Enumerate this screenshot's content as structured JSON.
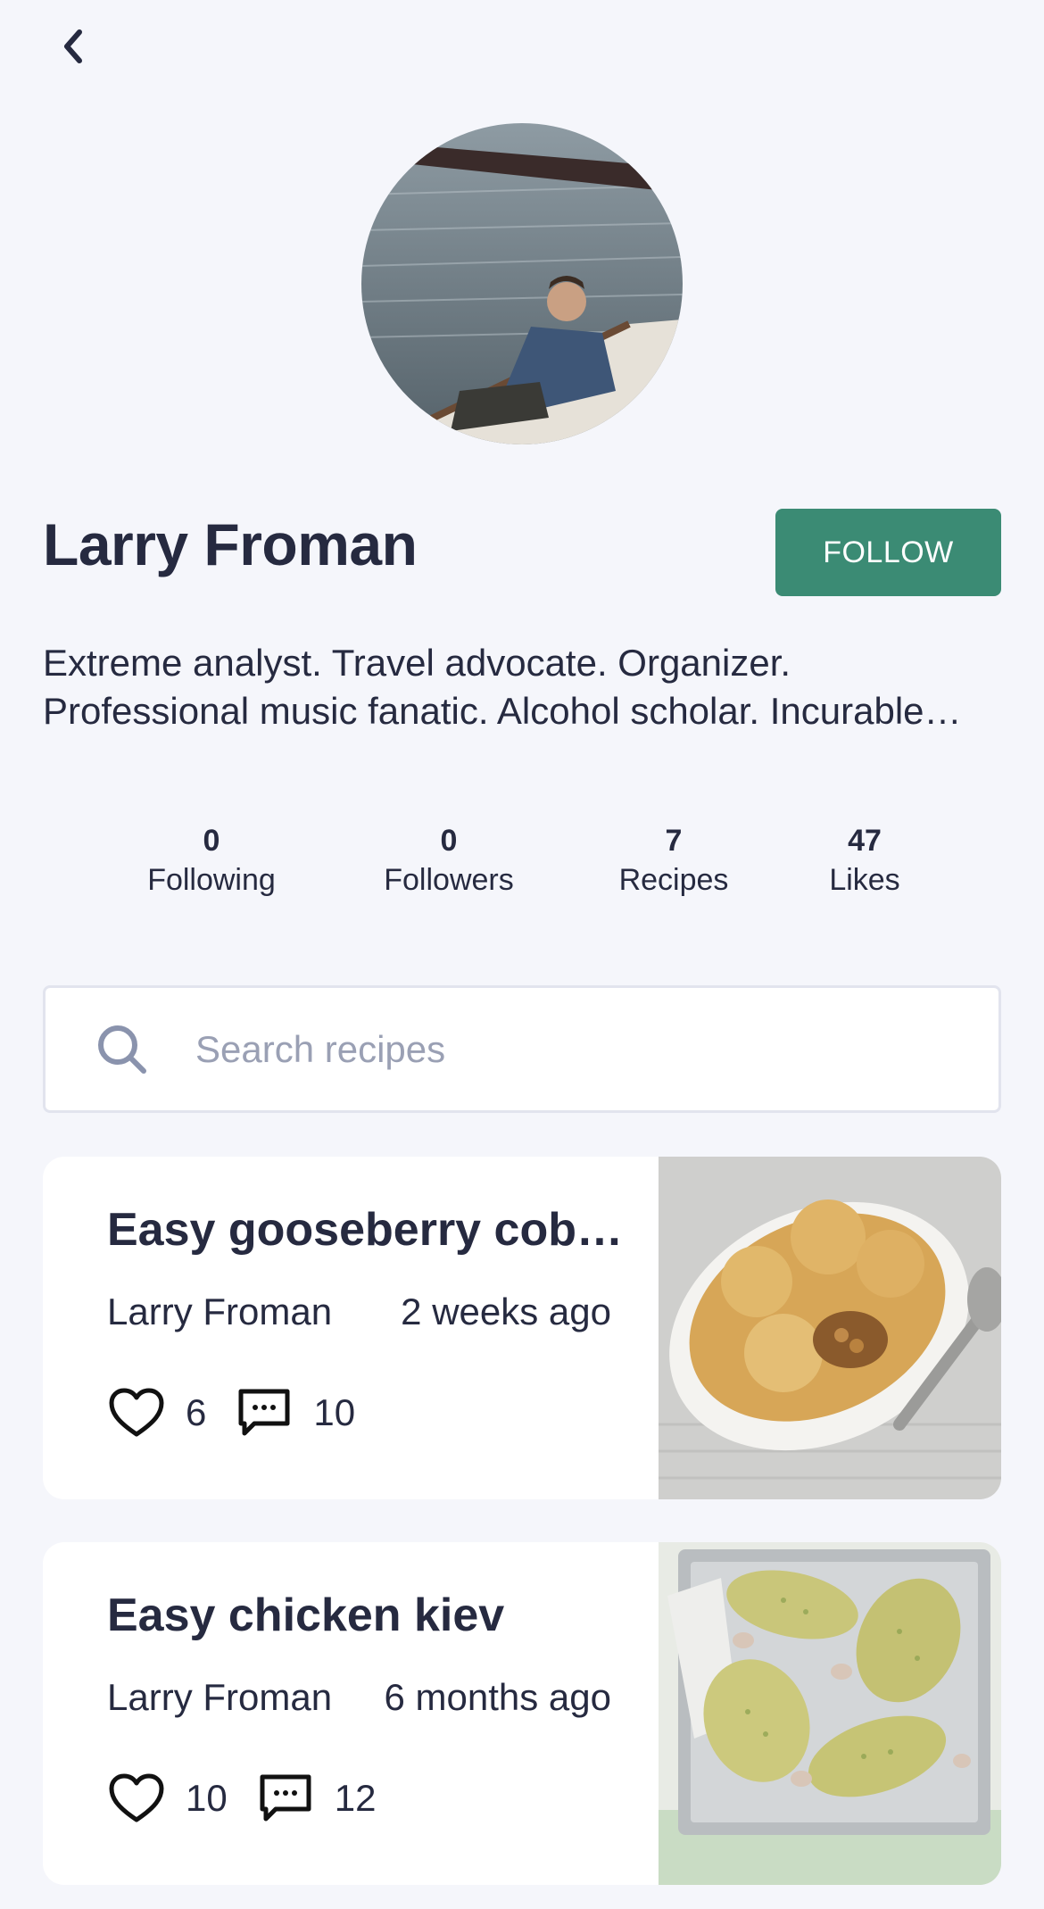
{
  "profile": {
    "name": "Larry Froman",
    "follow_label": "FOLLOW",
    "bio_line1": "Extreme analyst. Travel advocate. Organizer.",
    "bio_line2": "Professional music fanatic. Alcohol scholar. Incurable…"
  },
  "stats": {
    "following": {
      "value": "0",
      "label": "Following"
    },
    "followers": {
      "value": "0",
      "label": "Followers"
    },
    "recipes": {
      "value": "7",
      "label": "Recipes"
    },
    "likes": {
      "value": "47",
      "label": "Likes"
    }
  },
  "search": {
    "placeholder": "Search recipes",
    "value": ""
  },
  "recipes": [
    {
      "title": "Easy gooseberry cobb…",
      "author": "Larry Froman",
      "time": "2 weeks ago",
      "likes": "6",
      "comments": "10"
    },
    {
      "title": "Easy chicken kiev",
      "author": "Larry Froman",
      "time": "6 months ago",
      "likes": "10",
      "comments": "12"
    }
  ],
  "colors": {
    "background": "#f5f6fb",
    "accent": "#3b8b74",
    "text": "#262a40",
    "placeholder": "#9aa0b4"
  },
  "icons": {
    "back": "chevron-left-icon",
    "search": "search-icon",
    "like": "heart-icon",
    "comment": "comment-icon"
  }
}
